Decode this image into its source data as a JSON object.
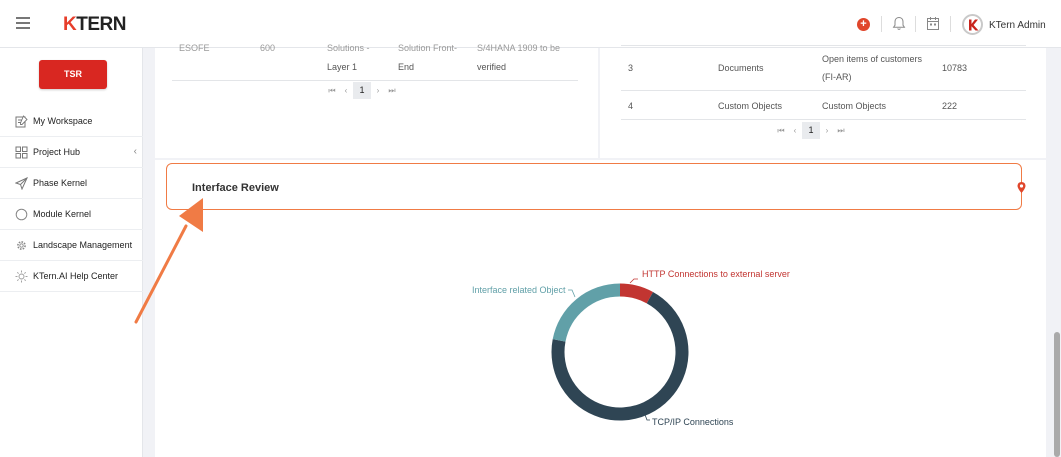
{
  "header": {
    "logo": "TERN",
    "logo_k": "K",
    "user_name": "KTern Admin",
    "plus_symbol": "+"
  },
  "sidebar": {
    "tsr_label": "TSR",
    "items": [
      {
        "label": "My Workspace",
        "icon": "workspace-icon"
      },
      {
        "label": "Project Hub",
        "icon": "grid-icon",
        "chevron": "‹"
      },
      {
        "label": "Phase Kernel",
        "icon": "paper-plane-icon"
      },
      {
        "label": "Module Kernel",
        "icon": "circle-icon"
      },
      {
        "label": "Landscape Management",
        "icon": "gear-icon"
      },
      {
        "label": "KTern.AI Help Center",
        "icon": "sun-icon"
      }
    ]
  },
  "left_table": {
    "row_top": [
      "ESOFE",
      "600",
      "Solutions -",
      "Solution Front-",
      "S/4HANA 1909 to be"
    ],
    "row_bottom": [
      "Layer 1",
      "End",
      "verified"
    ],
    "pager": {
      "first": "⏮",
      "prev": "‹",
      "page": "1",
      "next": "›",
      "last": "⏭"
    }
  },
  "right_table": {
    "rows": [
      {
        "no": "3",
        "type": "Documents",
        "desc_line1": "Open items of customers",
        "desc_line2": "(FI-AR)",
        "count": "10783"
      },
      {
        "no": "4",
        "type": "Custom Objects",
        "desc_line1": "Custom Objects",
        "desc_line2": "",
        "count": "222"
      }
    ],
    "pager": {
      "first": "⏮",
      "prev": "‹",
      "page": "1",
      "next": "›",
      "last": "⏭"
    }
  },
  "review": {
    "title": "Interface Review"
  },
  "chart_data": {
    "type": "pie",
    "labels": [
      "HTTP Connections to external server",
      "Interface related Object",
      "TCP/IP Connections"
    ],
    "values": [
      8,
      22,
      70
    ],
    "colors": [
      "#c23531",
      "#61a0a8",
      "#2f4554"
    ]
  },
  "colors": {
    "accent": "#f07b45",
    "brand_red": "#d92721"
  }
}
